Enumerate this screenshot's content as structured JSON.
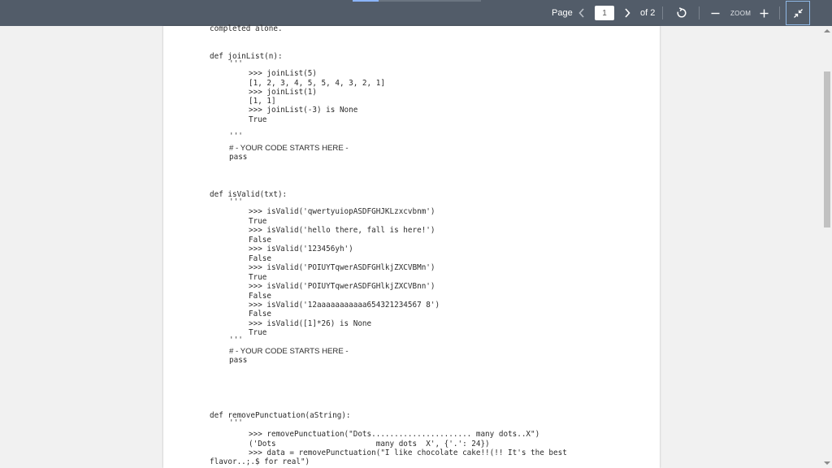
{
  "toolbar": {
    "page_label": "Page",
    "current_page": "1",
    "total_pages": "of 2",
    "zoom_label": "ZOOM",
    "load_progress": 0.2,
    "icons": {
      "prev": "chevron-left-icon",
      "next": "chevron-right-icon",
      "rotate": "rotate-icon",
      "zoom_out": "minus-icon",
      "zoom_in": "plus-icon",
      "fit": "fit-to-width-icon"
    }
  },
  "colors": {
    "toolbar_bg": "#525c69",
    "viewer_bg": "#f1f1f1",
    "page_bg": "#ffffff",
    "fit_button_border": "#8fb8e6"
  },
  "document": {
    "lines": [
      "completed alone.",
      "def joinList(n):",
      "'''",
      ">>> joinList(5)",
      "[1, 2, 3, 4, 5, 5, 4, 3, 2, 1]",
      ">>> joinList(1)",
      "[1, 1]",
      ">>> joinList(-3) is None",
      "True",
      "'''",
      "# - YOUR CODE STARTS HERE -",
      "pass",
      "def isValid(txt):",
      "'''",
      ">>> isValid('qwertyuiopASDFGHJKLzxcvbnm')",
      "True",
      ">>> isValid('hello there, fall is here!')",
      "False",
      ">>> isValid('123456yh')",
      "False",
      ">>> isValid('POIUYTqwerASDFGHlkjZXCVBMn')",
      "True",
      ">>> isValid('POIUYTqwerASDFGHlkjZXCVBnn')",
      "False",
      ">>> isValid('12aaaaaaaaaaa654321234567 8')",
      "False",
      ">>> isValid([1]*26) is None",
      "True",
      "'''",
      "# - YOUR CODE STARTS HERE -",
      "pass",
      "def removePunctuation(aString):",
      "'''",
      ">>> removePunctuation(\"Dots...................... many dots..X\")",
      "('Dots                      many dots  X', {'.': 24})",
      ">>> data = removePunctuation(\"I like chocolate cake!!(!! It's the best",
      "flavor..;.$ for real\")"
    ]
  }
}
